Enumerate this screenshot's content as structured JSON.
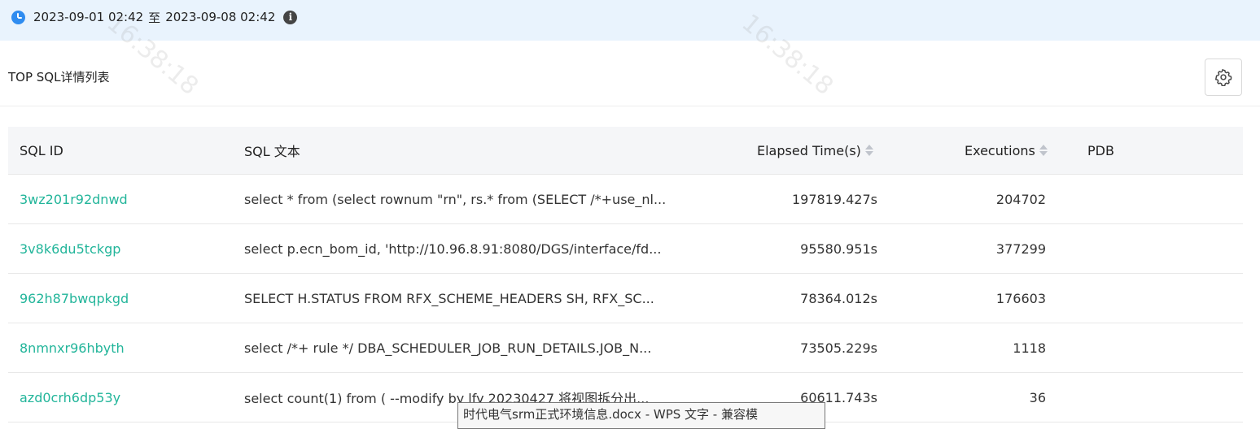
{
  "time_range": {
    "start": "2023-09-01 02:42",
    "separator": "至",
    "end": "2023-09-08 02:42"
  },
  "panel": {
    "title": "TOP SQL详情列表"
  },
  "table": {
    "columns": [
      "SQL ID",
      "SQL 文本",
      "Elapsed Time(s)",
      "Executions",
      "PDB"
    ],
    "rows": [
      {
        "sql_id": "3wz201r92dnwd",
        "sql_text": "select * from (select rownum \"rn\", rs.* from (SELECT /*+use_nl...",
        "elapsed": "197819.427s",
        "executions": "204702",
        "pdb": ""
      },
      {
        "sql_id": "3v8k6du5tckgp",
        "sql_text": "select p.ecn_bom_id, 'http://10.96.8.91:8080/DGS/interface/fd...",
        "elapsed": "95580.951s",
        "executions": "377299",
        "pdb": ""
      },
      {
        "sql_id": "962h87bwqpkgd",
        "sql_text": "SELECT H.STATUS FROM RFX_SCHEME_HEADERS SH, RFX_SC...",
        "elapsed": "78364.012s",
        "executions": "176603",
        "pdb": ""
      },
      {
        "sql_id": "8nmnxr96hbyth",
        "sql_text": "select /*+ rule */ DBA_SCHEDULER_JOB_RUN_DETAILS.JOB_N...",
        "elapsed": "73505.229s",
        "executions": "1118",
        "pdb": ""
      },
      {
        "sql_id": "azd0crh6dp53y",
        "sql_text": "select count(1) from ( --modify by lfy 20230427 将视图拆分出...",
        "elapsed": "60611.743s",
        "executions": "36",
        "pdb": ""
      }
    ]
  },
  "tooltip": {
    "text": "时代电气srm正式环境信息.docx - WPS 文字 - 兼容模"
  },
  "watermark": {
    "text": "16:38:18"
  },
  "icons": {
    "clock": "clock-icon",
    "info": "info-icon",
    "settings": "gear-icon",
    "sort": "sort-icon"
  },
  "colors": {
    "topbar_bg": "#e9f3fd",
    "accent": "#2f8cf0",
    "link": "#22b59a",
    "header_bg": "#f5f6f8"
  }
}
